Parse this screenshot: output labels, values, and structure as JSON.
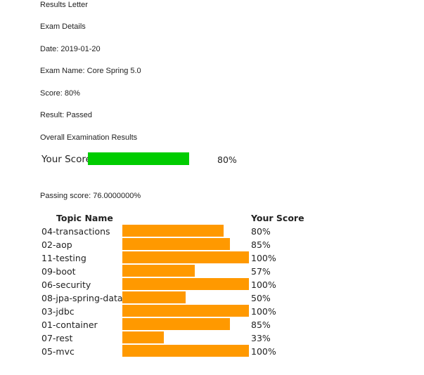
{
  "letter": {
    "title": "Results Letter",
    "section": "Exam Details",
    "date": "Date: 2019-01-20",
    "exam_name": "Exam Name: Core Spring 5.0",
    "score": "Score: 80%",
    "result": "Result: Passed",
    "overall_heading": "Overall Examination Results",
    "passing_score": "Passing score: 76.0000000%"
  },
  "overall": {
    "label": "Your Score",
    "percent_text": "80%",
    "percent": 80,
    "bar_color": "#00cc00"
  },
  "topics_table": {
    "header_topic": "Topic Name",
    "header_score": "Your Score",
    "bar_color": "#ff9900",
    "rows": [
      {
        "name": "04-transactions",
        "percent": 80,
        "percent_text": "80%"
      },
      {
        "name": "02-aop",
        "percent": 85,
        "percent_text": "85%"
      },
      {
        "name": "11-testing",
        "percent": 100,
        "percent_text": "100%"
      },
      {
        "name": "09-boot",
        "percent": 57,
        "percent_text": "57%"
      },
      {
        "name": "06-security",
        "percent": 100,
        "percent_text": "100%"
      },
      {
        "name": "08-jpa-spring-data",
        "percent": 50,
        "percent_text": "50%"
      },
      {
        "name": "03-jdbc",
        "percent": 100,
        "percent_text": "100%"
      },
      {
        "name": "01-container",
        "percent": 85,
        "percent_text": "85%"
      },
      {
        "name": "07-rest",
        "percent": 33,
        "percent_text": "33%"
      },
      {
        "name": "05-mvc",
        "percent": 100,
        "percent_text": "100%"
      }
    ]
  }
}
